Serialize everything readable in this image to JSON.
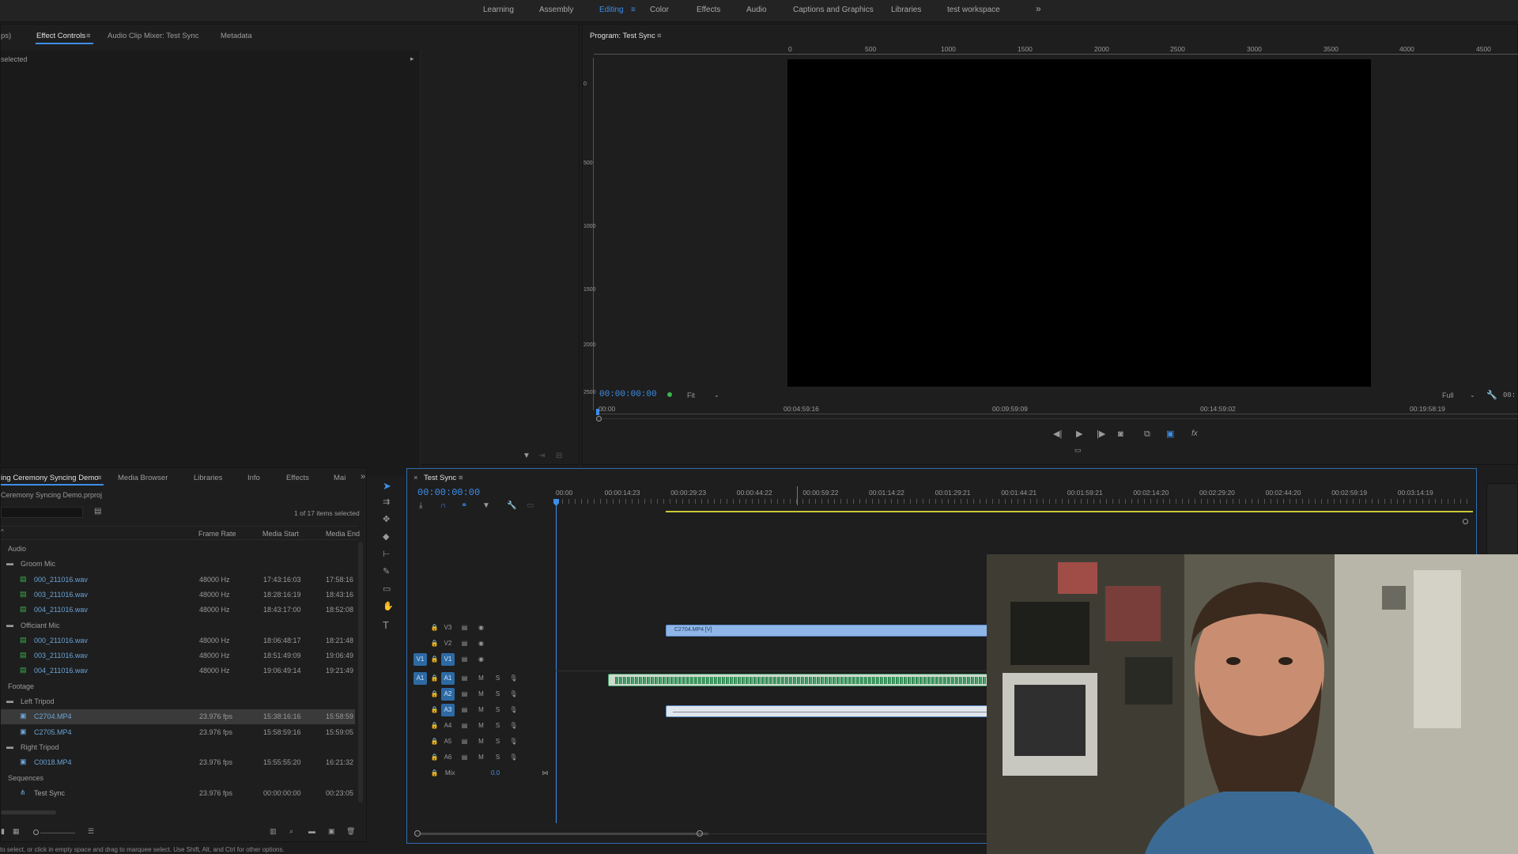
{
  "workspaces": [
    "Learning",
    "Assembly",
    "Editing",
    "Color",
    "Effects",
    "Audio",
    "Captions and Graphics",
    "Libraries",
    "test workspace"
  ],
  "workspace_more": "»",
  "left_top_tabs": {
    "cut": "ps)",
    "effect_controls": "Effect Controls",
    "mixer": "Audio Clip Mixer: Test Sync",
    "metadata": "Metadata"
  },
  "effect_controls_msg": "selected",
  "program": {
    "title": "Program: Test Sync",
    "timecode": "00:00:00:00",
    "fit": "Fit",
    "full": "Full",
    "end_tc": "00:",
    "ruler": [
      "00:00",
      "00:04:59:16",
      "00:09:59:09",
      "00:14:59:02",
      "00:19:58:19"
    ],
    "top_ruler": [
      "0",
      "500",
      "1000",
      "1500",
      "2000",
      "2500",
      "3000",
      "3500",
      "4000",
      "4500"
    ],
    "side_ruler": [
      "0",
      "500",
      "1000",
      "1500",
      "2000",
      "2500"
    ]
  },
  "project": {
    "tabs": [
      "ing Ceremony Syncing Demo",
      "Media Browser",
      "Libraries",
      "Info",
      "Effects",
      "Mai"
    ],
    "path": "Ceremony Syncing Demo.prproj",
    "count": "1 of 17 items selected",
    "columns": [
      "Frame Rate",
      "Media Start",
      "Media End"
    ],
    "rows": [
      {
        "name": "Audio",
        "type": "group",
        "rate": "",
        "start": "",
        "end": ""
      },
      {
        "name": "Groom Mic",
        "type": "bin",
        "rate": "",
        "start": "",
        "end": ""
      },
      {
        "name": "000_211016.wav",
        "type": "audio",
        "rate": "48000 Hz",
        "start": "17:43:16:03",
        "end": "17:58:16"
      },
      {
        "name": "003_211016.wav",
        "type": "audio",
        "rate": "48000 Hz",
        "start": "18:28:16:19",
        "end": "18:43:16"
      },
      {
        "name": "004_211016.wav",
        "type": "audio",
        "rate": "48000 Hz",
        "start": "18:43:17:00",
        "end": "18:52:08"
      },
      {
        "name": "Officiant Mic",
        "type": "bin",
        "rate": "",
        "start": "",
        "end": ""
      },
      {
        "name": "000_211016.wav",
        "type": "audio",
        "rate": "48000 Hz",
        "start": "18:06:48:17",
        "end": "18:21:48"
      },
      {
        "name": "003_211016.wav",
        "type": "audio",
        "rate": "48000 Hz",
        "start": "18:51:49:09",
        "end": "19:06:49"
      },
      {
        "name": "004_211016.wav",
        "type": "audio",
        "rate": "48000 Hz",
        "start": "19:06:49:14",
        "end": "19:21:49"
      },
      {
        "name": "Footage",
        "type": "group",
        "rate": "",
        "start": "",
        "end": ""
      },
      {
        "name": "Left Tripod",
        "type": "bin",
        "rate": "",
        "start": "",
        "end": ""
      },
      {
        "name": "C2704.MP4",
        "type": "video",
        "rate": "23.976 fps",
        "start": "15:38:16:16",
        "end": "15:58:59",
        "selected": true
      },
      {
        "name": "C2705.MP4",
        "type": "video",
        "rate": "23.976 fps",
        "start": "15:58:59:16",
        "end": "15:59:05"
      },
      {
        "name": "Right Tripod",
        "type": "bin",
        "rate": "",
        "start": "",
        "end": ""
      },
      {
        "name": "C0018.MP4",
        "type": "video",
        "rate": "23.976 fps",
        "start": "15:55:55:20",
        "end": "16:21:32"
      },
      {
        "name": "Sequences",
        "type": "group",
        "rate": "",
        "start": "",
        "end": ""
      },
      {
        "name": "Test Sync",
        "type": "seq",
        "rate": "23.976 fps",
        "start": "00:00:00:00",
        "end": "00:23:05"
      }
    ]
  },
  "timeline": {
    "title": "Test Sync",
    "timecode": "00:00:00:00",
    "ruler": [
      "00:00",
      "00:00:14:23",
      "00:00:29:23",
      "00:00:44:22",
      "00:00:59:22",
      "00:01:14:22",
      "00:01:29:21",
      "00:01:44:21",
      "00:01:59:21",
      "00:02:14:20",
      "00:02:29:20",
      "00:02:44:20",
      "00:02:59:19",
      "00:03:14:19"
    ],
    "video_tracks": [
      "V3",
      "V2",
      "V1"
    ],
    "audio_tracks": [
      "A1",
      "A2",
      "A3",
      "A4",
      "A5",
      "A6"
    ],
    "mix_label": "Mix",
    "mix_value": "0.0",
    "src_v": "V1",
    "src_a": "A1",
    "clip_v": "C2704.MP4 [V]",
    "m": "M",
    "s": "S"
  },
  "status": "to select, or click in empty space and drag to marquee select. Use Shift, Alt, and Ctrl for other options."
}
